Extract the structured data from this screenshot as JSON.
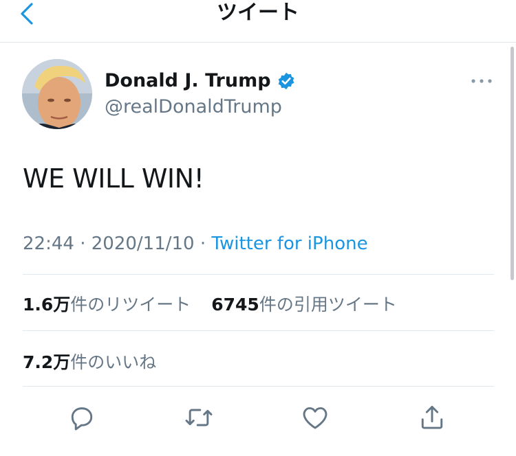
{
  "nav": {
    "title": "ツイート"
  },
  "tweet": {
    "author_name": "Donald J. Trump",
    "author_handle": "@realDonaldTrump",
    "text": "WE WILL WIN!",
    "time": "22:44",
    "date": "2020/11/10",
    "separator": "·",
    "source": "Twitter for iPhone"
  },
  "stats": {
    "retweets_count": "1.6万",
    "retweets_label": "件のリツイート",
    "quotes_count": "6745",
    "quotes_label": "件の引用ツイート",
    "likes_count": "7.2万",
    "likes_label": "件のいいね"
  },
  "icons": {
    "back": "chevron-left-icon",
    "verified": "verified-badge-icon",
    "more": "more-horizontal-icon",
    "reply": "reply-icon",
    "retweet": "retweet-icon",
    "like": "heart-icon",
    "share": "share-icon"
  },
  "colors": {
    "accent": "#1b95e0",
    "secondary_text": "#657786",
    "primary_text": "#14171a",
    "divider": "#e1e8ed"
  }
}
